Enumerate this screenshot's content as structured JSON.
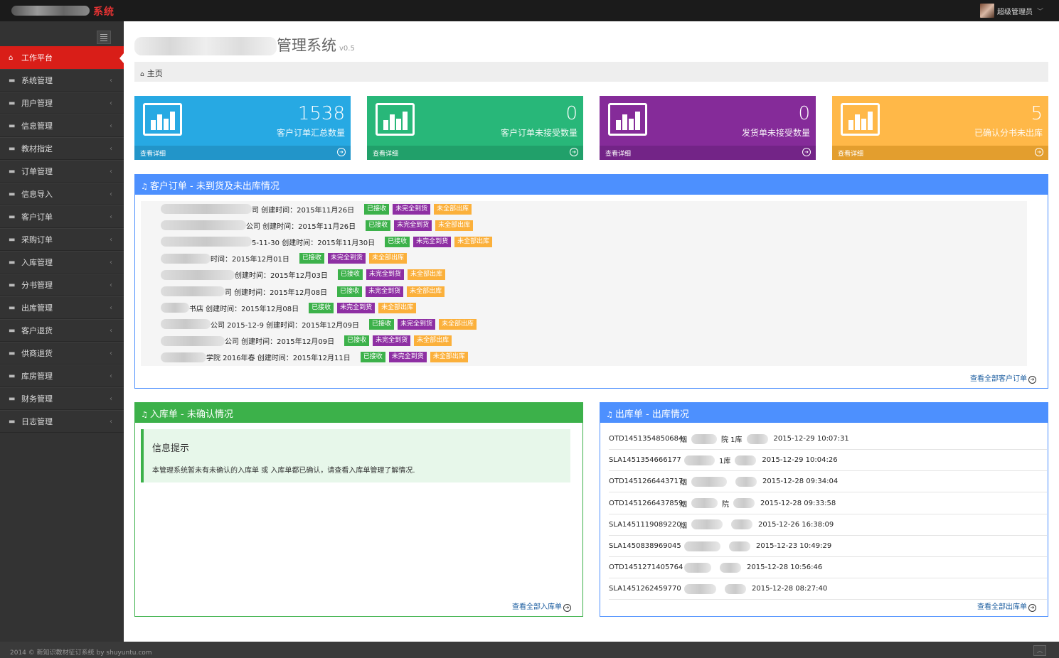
{
  "header": {
    "logo_text": "系统",
    "user_name": "超级管理员"
  },
  "sidebar": {
    "items": [
      {
        "label": "工作平台",
        "active": true
      },
      {
        "label": "系统管理"
      },
      {
        "label": "用户管理"
      },
      {
        "label": "信息管理"
      },
      {
        "label": "教材指定"
      },
      {
        "label": "订单管理"
      },
      {
        "label": "信息导入"
      },
      {
        "label": "客户订单"
      },
      {
        "label": "采购订单"
      },
      {
        "label": "入库管理"
      },
      {
        "label": "分书管理"
      },
      {
        "label": "出库管理"
      },
      {
        "label": "客户退货"
      },
      {
        "label": "供商退货"
      },
      {
        "label": "库房管理"
      },
      {
        "label": "财务管理"
      },
      {
        "label": "日志管理"
      }
    ]
  },
  "page": {
    "title_visible": "管理系统",
    "version": "v0.5",
    "breadcrumb": "主页"
  },
  "stats": [
    {
      "value": "1538",
      "label": "客户订单汇总数量",
      "more": "查看详细",
      "color": "#27a9e3",
      "footer_color": "#2295c9"
    },
    {
      "value": "0",
      "label": "客户订单未接受数量",
      "more": "查看详细",
      "color": "#28b779",
      "footer_color": "#21a06a"
    },
    {
      "value": "0",
      "label": "发货单未接受数量",
      "more": "查看详细",
      "color": "#852b99",
      "footer_color": "#732487"
    },
    {
      "value": "5",
      "label": "已确认分书未出库",
      "more": "查看详细",
      "color": "#ffb848",
      "footer_color": "#e39e2e"
    }
  ],
  "orders_panel": {
    "title": "客户订单 - 未到货及未出库情况",
    "footer": "查看全部客户订单",
    "rows": [
      {
        "text": "司  创建时间：2015年11月26日"
      },
      {
        "text": "公司  创建时间：2015年11月26日"
      },
      {
        "text": "5-11-30  创建时间：2015年11月30日"
      },
      {
        "text": "时间：2015年12月01日"
      },
      {
        "text": "创建时间：2015年12月03日"
      },
      {
        "text": "司  创建时间：2015年12月08日"
      },
      {
        "text": "书店  创建时间：2015年12月08日"
      },
      {
        "text": "公司  2015-12-9  创建时间：2015年12月09日"
      },
      {
        "text": "公司  创建时间：2015年12月09日"
      },
      {
        "text": "学院  2016年春  创建时间：2015年12月11日"
      }
    ],
    "badges": [
      "已接收",
      "未完全到货",
      "未全部出库"
    ]
  },
  "inbound_panel": {
    "title": "入库单 - 未确认情况",
    "alert_title": "信息提示",
    "alert_text": "本管理系统暂未有未确认的入库单 或 入库单都已确认，请查看入库单管理了解情况.",
    "footer": "查看全部入库单"
  },
  "outbound_panel": {
    "title": "出库单 - 出库情况",
    "footer": "查看全部出库单",
    "rows": [
      {
        "code": "OTD1451354850684",
        "mid": "烟",
        "tail": "院  1库",
        "time": "2015-12-29 10:07:31"
      },
      {
        "code": "SLA1451354666177",
        "mid": "",
        "tail": "1库",
        "time": "2015-12-29 10:04:26"
      },
      {
        "code": "OTD1451266443717",
        "mid": "烟",
        "tail": "",
        "time": "2015-12-28 09:34:04"
      },
      {
        "code": "OTD1451266437859",
        "mid": "烟",
        "tail": "院",
        "time": "2015-12-28 09:33:58"
      },
      {
        "code": "SLA1451119089220",
        "mid": "烟",
        "tail": "",
        "time": "2015-12-26 16:38:09"
      },
      {
        "code": "SLA1450838969045",
        "mid": "",
        "tail": "",
        "time": "2015-12-23 10:49:29"
      },
      {
        "code": "OTD1451271405764",
        "mid": "",
        "tail": "",
        "time": "2015-12-28 10:56:46"
      },
      {
        "code": "SLA1451262459770",
        "mid": "",
        "tail": "",
        "time": "2015-12-28 08:27:40"
      }
    ]
  },
  "footer": {
    "text": "2014 © 新知识教材征订系统 by shuyuntu.com"
  }
}
